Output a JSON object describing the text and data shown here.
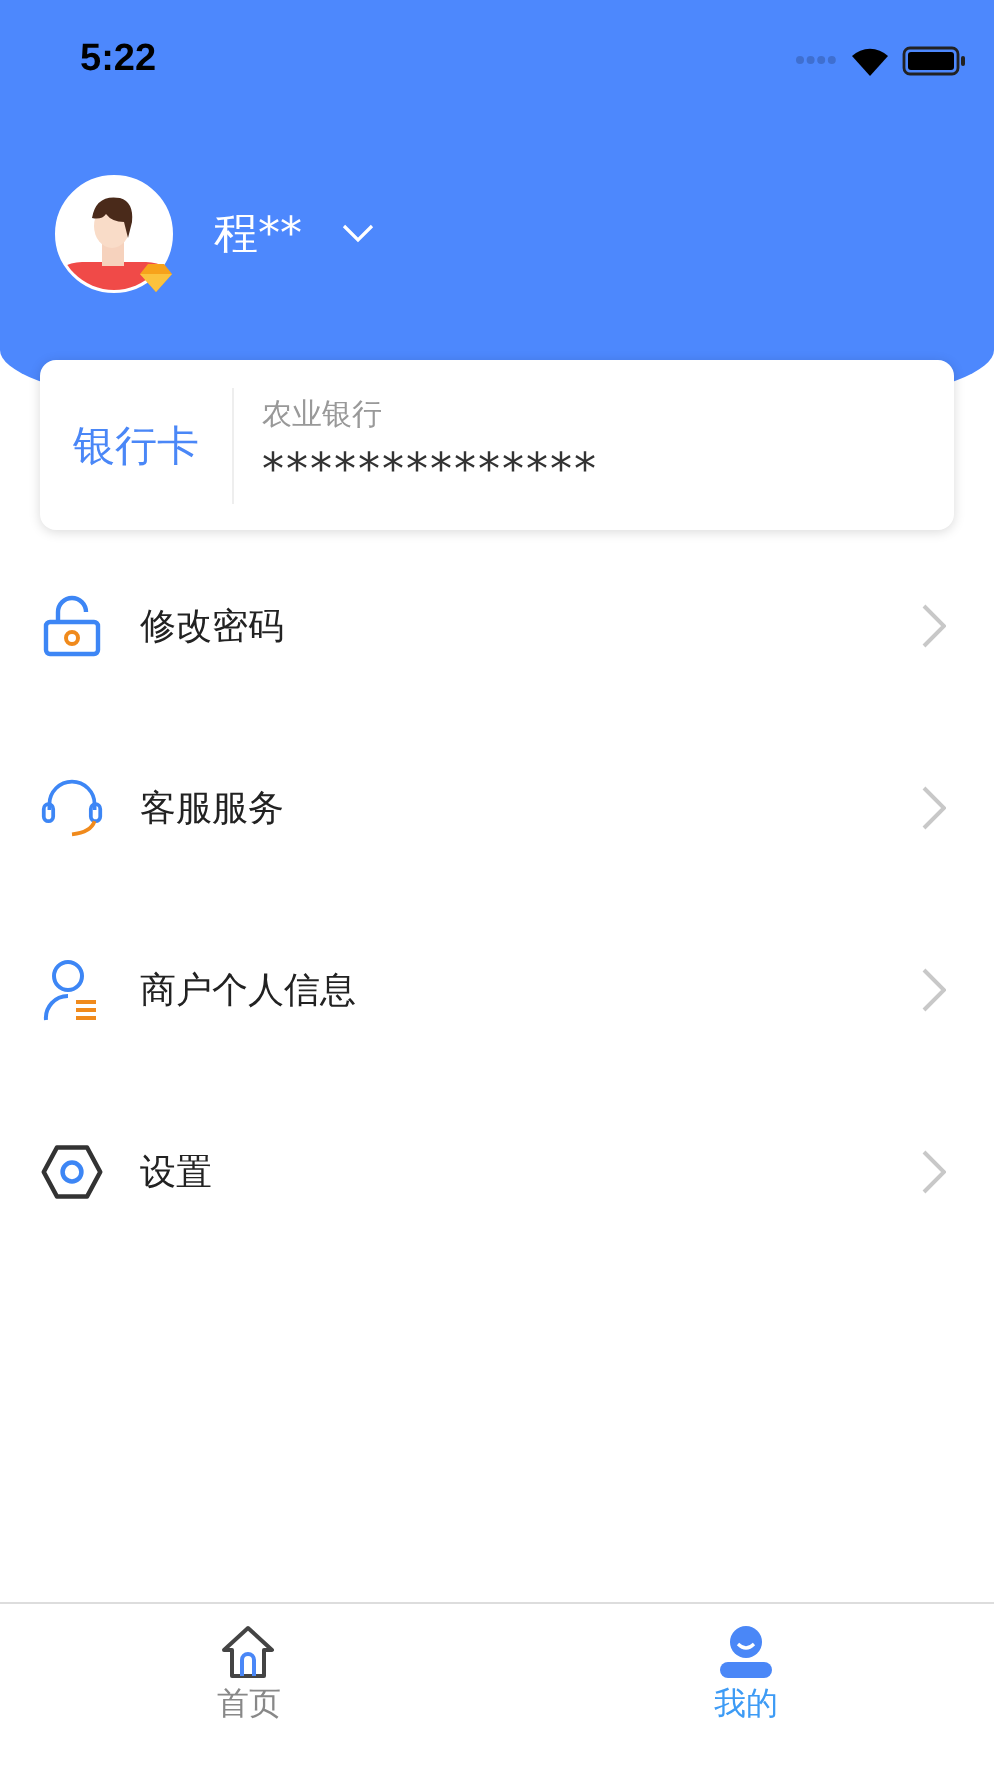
{
  "status_bar": {
    "time": "5:22"
  },
  "profile": {
    "name": "程**"
  },
  "bank_card": {
    "label": "银行卡",
    "bank": "农业银行",
    "number": "**************"
  },
  "menu": [
    {
      "kind": "password",
      "label": "修改密码"
    },
    {
      "kind": "service",
      "label": "客服服务"
    },
    {
      "kind": "merchant",
      "label": "商户个人信息"
    },
    {
      "kind": "settings",
      "label": "设置"
    }
  ],
  "tab_bar": [
    {
      "kind": "home",
      "label": "首页",
      "selected": false
    },
    {
      "kind": "mine",
      "label": "我的",
      "selected": true
    }
  ]
}
